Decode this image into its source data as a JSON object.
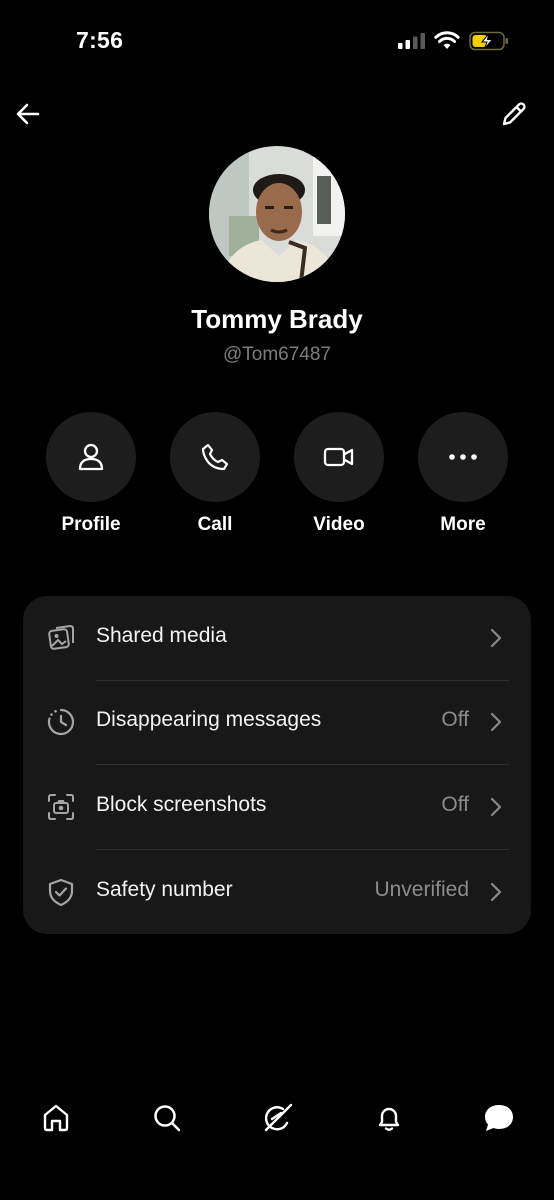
{
  "status_bar": {
    "time": "7:56",
    "icons": [
      "signal-icon",
      "wifi-icon",
      "battery-charging-icon"
    ]
  },
  "header": {
    "back_icon": "arrow-left-icon",
    "edit_icon": "pencil-icon"
  },
  "profile": {
    "name": "Tommy Brady",
    "handle": "@Tom67487"
  },
  "actions": [
    {
      "label": "Profile",
      "icon": "person-icon"
    },
    {
      "label": "Call",
      "icon": "phone-icon"
    },
    {
      "label": "Video",
      "icon": "video-camera-icon"
    },
    {
      "label": "More",
      "icon": "ellipsis-icon"
    }
  ],
  "settings": [
    {
      "label": "Shared media",
      "value": "",
      "icon": "shared-media-icon"
    },
    {
      "label": "Disappearing messages",
      "value": "Off",
      "icon": "timer-icon"
    },
    {
      "label": "Block screenshots",
      "value": "Off",
      "icon": "screenshot-camera-icon"
    },
    {
      "label": "Safety number",
      "value": "Unverified",
      "icon": "shield-check-icon"
    }
  ],
  "tab_bar": [
    "home-icon",
    "search-icon",
    "grok-icon",
    "notifications-bell-icon",
    "messages-icon"
  ],
  "colors": {
    "background": "#000000",
    "surface": "#181818",
    "action_circle": "#1d1d1d",
    "muted_text": "#7d7d7d",
    "battery_accent": "#f5d000"
  }
}
